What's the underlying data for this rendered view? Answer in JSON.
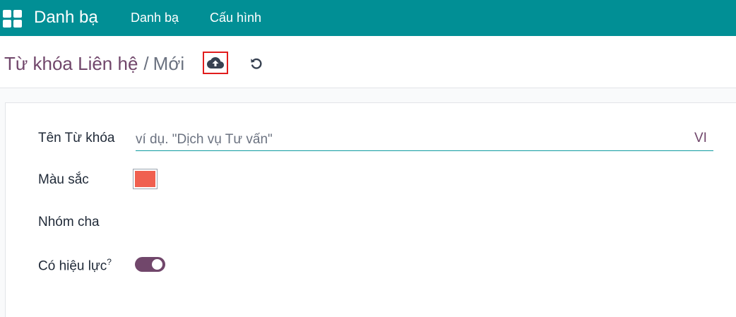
{
  "navbar": {
    "app_title": "Danh bạ",
    "menu": [
      "Danh bạ",
      "Cấu hình"
    ],
    "background": "#018f95"
  },
  "breadcrumb": {
    "parent": "Từ khóa Liên hệ",
    "separator": "/",
    "current": "Mới"
  },
  "toolbar": {
    "save_icon": "cloud-upload-icon",
    "discard_icon": "undo-icon"
  },
  "form": {
    "name_label": "Tên Từ khóa",
    "name_value": "",
    "name_placeholder": "ví dụ. \"Dịch vụ Tư vấn\"",
    "language_button": "VI",
    "color_label": "Màu sắc",
    "color_value": "#f06050",
    "parent_label": "Nhóm cha",
    "parent_value": "",
    "active_label": "Có hiệu lực",
    "active_tooltip_marker": "?",
    "active_value": true,
    "toggle_color": "#71476b"
  }
}
